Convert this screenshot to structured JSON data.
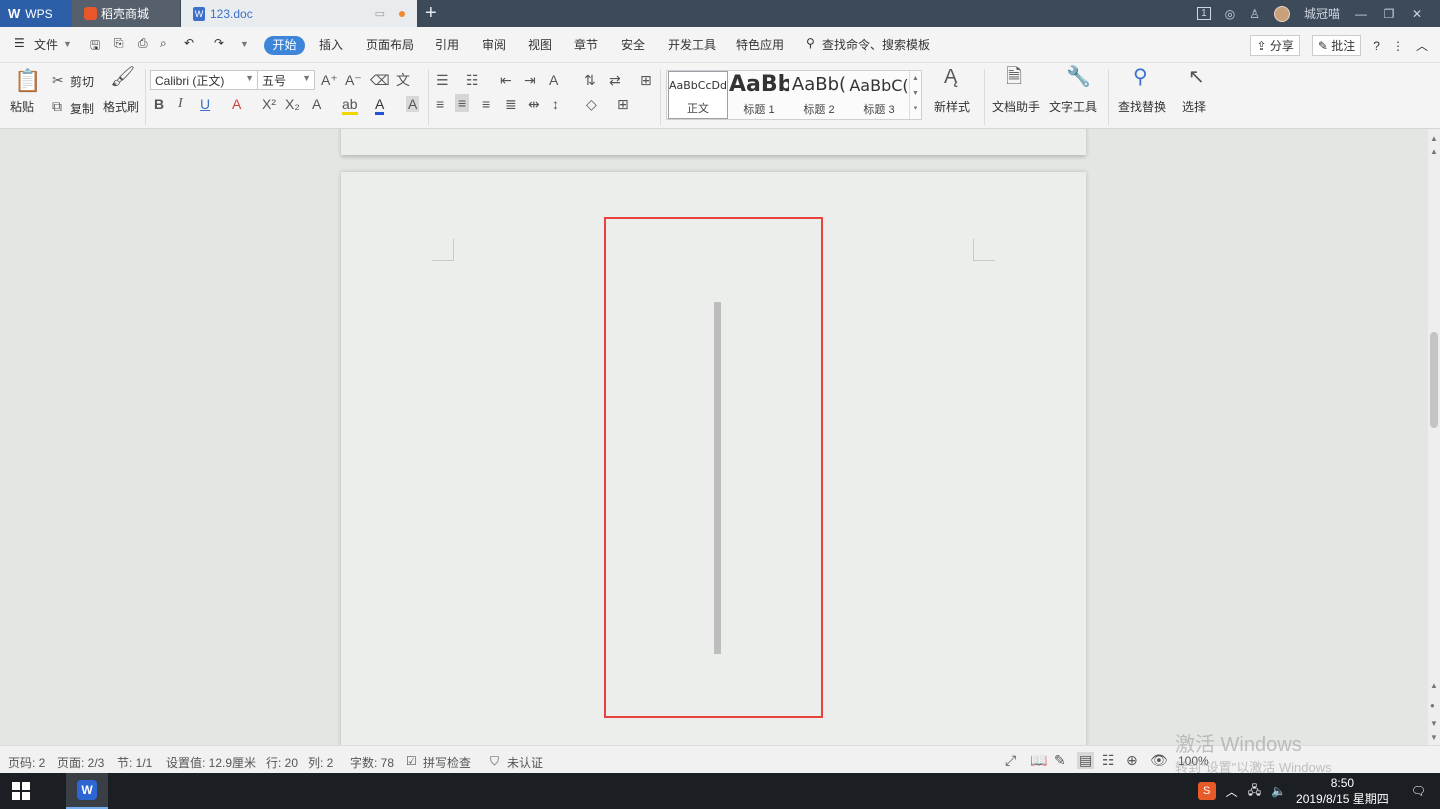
{
  "titlebar": {
    "tabs": [
      {
        "label": "WPS",
        "icon": "wps-logo-icon"
      },
      {
        "label": "稻壳商城",
        "icon": "daoke-store-icon"
      },
      {
        "label": "123.doc",
        "icon": "word-doc-icon"
      }
    ],
    "new_tab_label": "+",
    "page_indicator": "1",
    "username": "城冠喵"
  },
  "menubar": {
    "file_label": "文件",
    "active_tab": "开始",
    "tabs": [
      "插入",
      "页面布局",
      "引用",
      "审阅",
      "视图",
      "章节",
      "安全",
      "开发工具",
      "特色应用"
    ],
    "search_label": "查找命令、搜索模板",
    "share_label": "分享",
    "comment_label": "批注"
  },
  "ribbon": {
    "paste_label": "粘贴",
    "cut_label": "剪切",
    "copy_label": "复制",
    "format_painter_label": "格式刷",
    "font_name": "Calibri (正文)",
    "font_size": "五号",
    "styles": [
      {
        "sample": "AaBbCcDd",
        "name": "正文"
      },
      {
        "sample": "AaBb",
        "name": "标题 1"
      },
      {
        "sample": "AaBb(",
        "name": "标题 2"
      },
      {
        "sample": "AaBbC(",
        "name": "标题 3"
      }
    ],
    "new_style_label": "新样式",
    "doc_assistant_label": "文档助手",
    "text_tools_label": "文字工具",
    "find_replace_label": "查找替换",
    "select_label": "选择"
  },
  "statusbar": {
    "page_no": "页码: 2",
    "pages": "页面: 2/3",
    "section": "节: 1/1",
    "setting": "设置值: 12.9厘米",
    "row": "行: 20",
    "col": "列: 2",
    "word_count": "字数: 78",
    "spell_check": "拼写检查",
    "unverified": "未认证",
    "zoom": "100%"
  },
  "watermark": {
    "line1": "激活 Windows",
    "line2": "转到\"设置\"以激活 Windows"
  },
  "taskbar": {
    "time": "8:50",
    "date": "2019/8/15 星期四",
    "ime_label": "S"
  },
  "colors": {
    "accent": "#3d85d8",
    "highlight_box": "#e8413e",
    "titlebar": "#3c4a5a"
  }
}
